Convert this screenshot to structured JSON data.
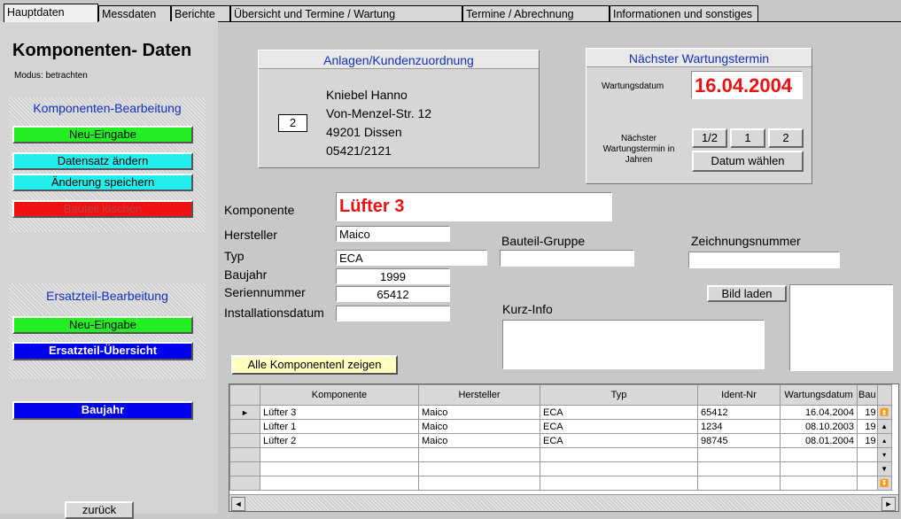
{
  "tabs": [
    "Hauptdaten",
    "Messdaten",
    "Berichte",
    "Übersicht und Termine /  Wartung",
    "Termine / Abrechnung",
    "Informationen und sonstiges"
  ],
  "title": "Komponenten- Daten",
  "modus": "Modus: betrachten",
  "komp_bearbeitung": {
    "heading": "Komponenten-Bearbeitung",
    "neu": "Neu-Eingabe",
    "aendern": "Datensatz ändern",
    "speichern": "Änderung speichern",
    "loeschen": "Bauteil löschen"
  },
  "ersatz_bearbeitung": {
    "heading": "Ersatzteil-Bearbeitung",
    "neu": "Neu-Eingabe",
    "uebersicht": "Ersatzteil-Übersicht"
  },
  "baujahr_button": "Baujahr",
  "zurueck_button": "zurück",
  "anlagen": {
    "heading": "Anlagen/Kundenzuordnung",
    "number": "2",
    "name": "Kniebel  Hanno",
    "street": "Von-Menzel-Str. 12",
    "city": "49201 Dissen",
    "phone": "05421/2121"
  },
  "wartung": {
    "heading": "Nächster Wartungstermin",
    "datum_label": "Wartungsdatum",
    "datum": "16.04.2004",
    "next_label": "Nächster Wartungstermin in Jahren",
    "b_half": "1/2",
    "b_1": "1",
    "b_2": "2",
    "datum_waehlen": "Datum wählen"
  },
  "form": {
    "komponente_label": "Komponente",
    "komponente": "Lüfter 3",
    "hersteller_label": "Hersteller",
    "hersteller": "Maico",
    "typ_label": "Typ",
    "typ": "ECA",
    "baujahr_label": "Baujahr",
    "baujahr": "1999",
    "seriennummer_label": "Seriennummer",
    "seriennummer": "65412",
    "installationsdatum_label": "Installationsdatum",
    "installationsdatum": "",
    "bauteilgruppe_label": "Bauteil-Gruppe",
    "bauteilgruppe": "",
    "zeichnungsnummer_label": "Zeichnungsnummer",
    "zeichnungsnummer": "",
    "kurzinfo_label": "Kurz-Info",
    "kurzinfo": "",
    "bild_laden": "Bild laden",
    "alle_zeigen": "Alle Komponentenl zeigen"
  },
  "table": {
    "headers": [
      "Komponente",
      "Hersteller",
      "Typ",
      "Ident-Nr",
      "Wartungsdatum",
      "Bau"
    ],
    "rows": [
      [
        "Lüfter 3",
        "Maico",
        "ECA",
        "65412",
        "16.04.2004",
        "19"
      ],
      [
        "Lüfter 1",
        "Maico",
        "ECA",
        "1234",
        "08.10.2003",
        "19"
      ],
      [
        "Lüfter 2",
        "Maico",
        "ECA",
        "98745",
        "08.01.2004",
        "19"
      ]
    ]
  },
  "colors": {
    "green": "#22ee22",
    "cyan": "#22eeee",
    "red": "#ee1111",
    "blue": "#0000ee",
    "date_red": "#ee1111"
  }
}
